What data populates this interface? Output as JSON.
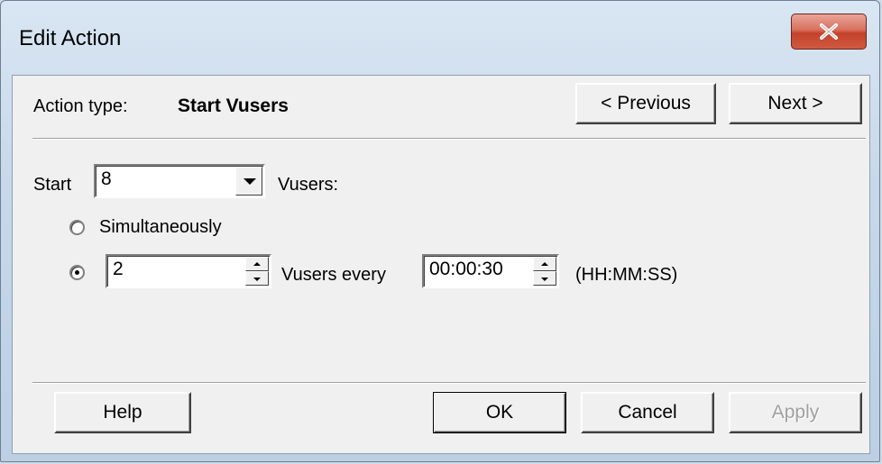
{
  "window": {
    "title": "Edit Action"
  },
  "header": {
    "action_type_label": "Action type:",
    "action_type_value": "Start Vusers",
    "previous_label": "< Previous",
    "next_label": "Next >"
  },
  "form": {
    "start_label": "Start",
    "vusers_count": "8",
    "vusers_label": "Vusers:",
    "option_simultaneously": "Simultaneously",
    "selected_option": "interval",
    "interval_vusers": "2",
    "vusers_every_label": "Vusers every",
    "interval_time": "00:00:30",
    "time_format_label": "(HH:MM:SS)"
  },
  "footer": {
    "help_label": "Help",
    "ok_label": "OK",
    "cancel_label": "Cancel",
    "apply_label": "Apply"
  }
}
